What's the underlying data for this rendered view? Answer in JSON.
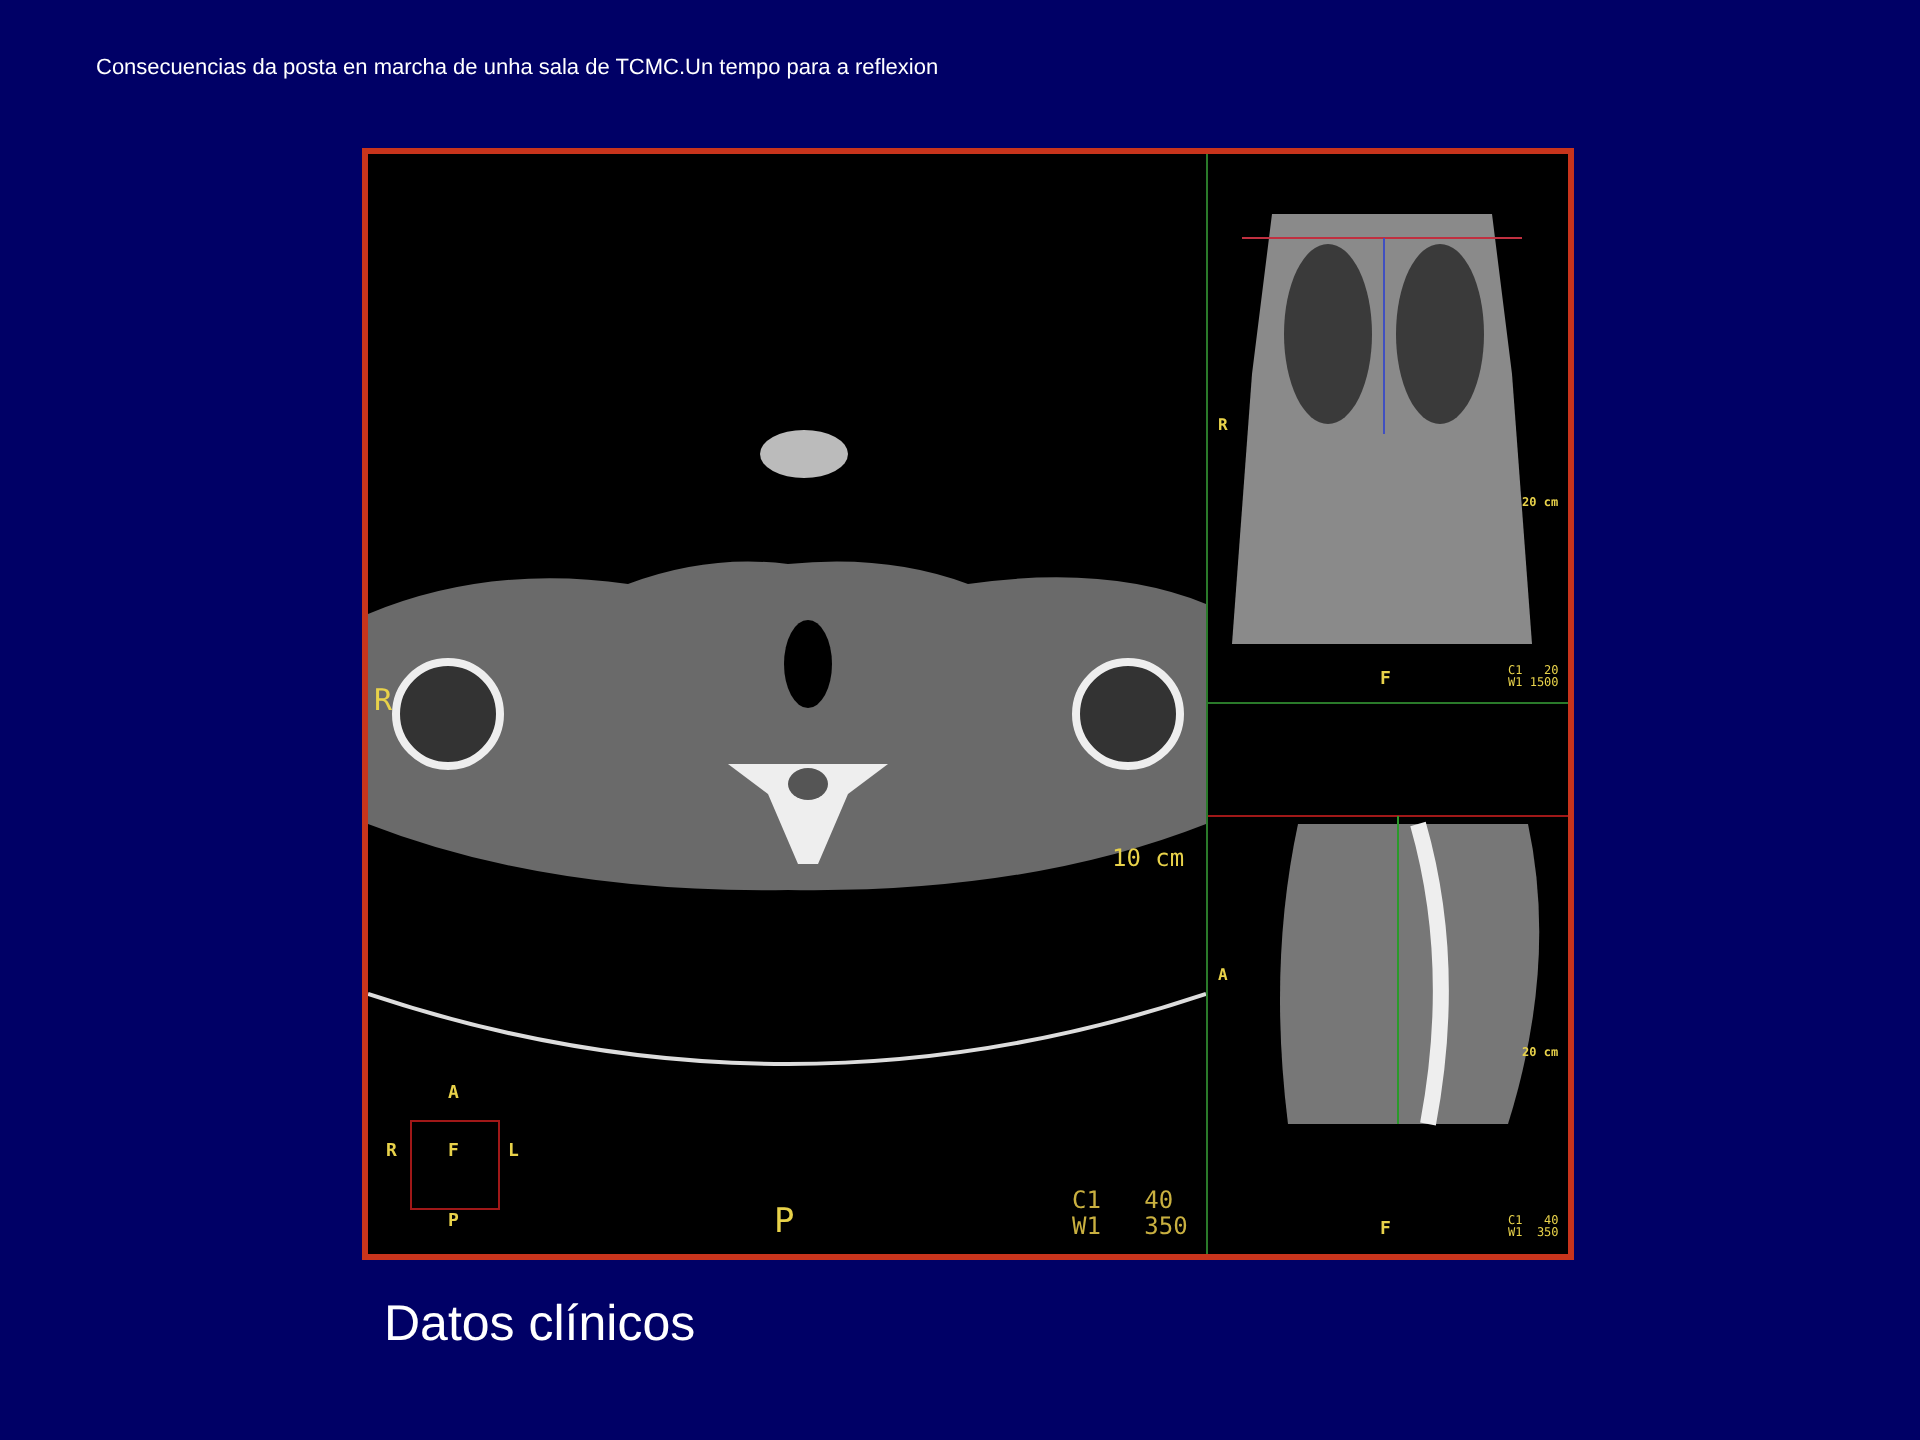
{
  "title": "Consecuencias da posta en marcha de unha sala de TCMC.Un tempo para a reflexion",
  "viewer": {
    "axial": {
      "side_marker": "R",
      "scale": "10 cm",
      "orientation": {
        "top": "A",
        "left": "R",
        "center": "F",
        "right": "L",
        "bottom": "P"
      },
      "bottom_marker": "P",
      "window": [
        "C1   40",
        "W1   350"
      ]
    },
    "coronal": {
      "side_marker": "R",
      "scale": "20 cm",
      "bottom_marker": "F",
      "window": [
        "C1   20",
        "W1 1500"
      ]
    },
    "sagittal": {
      "side_marker": "A",
      "scale": "20 cm",
      "bottom_marker": "F",
      "window": [
        "C1   40",
        "W1  350"
      ]
    }
  },
  "caption": "Datos clínicos"
}
